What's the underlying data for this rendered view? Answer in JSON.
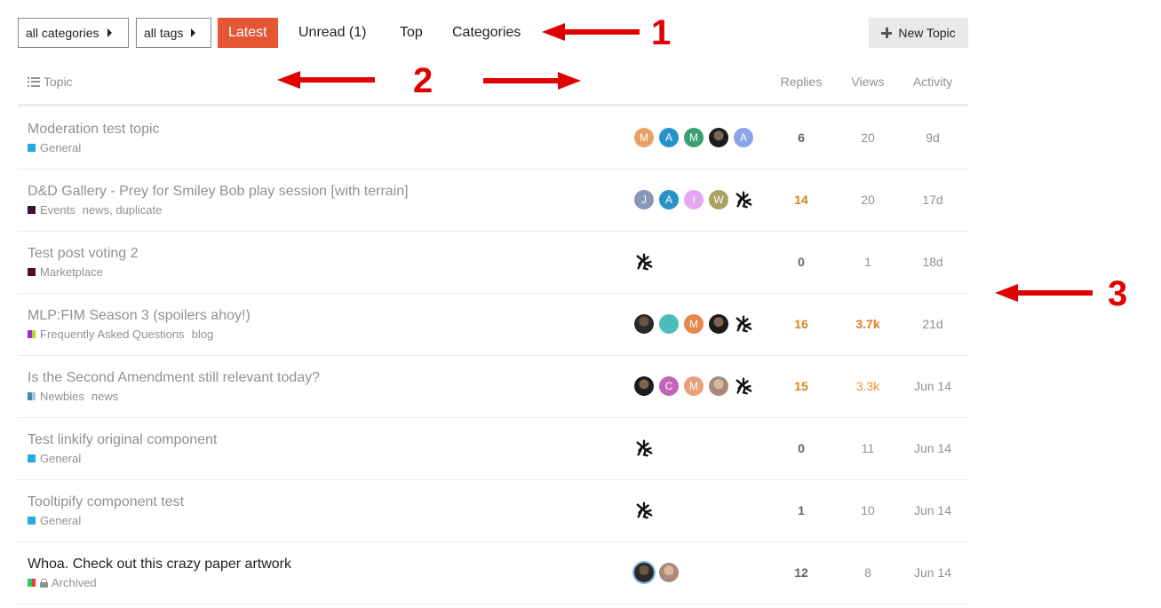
{
  "nav": {
    "categories_dropdown": "all categories",
    "tags_dropdown": "all tags",
    "items": [
      {
        "label": "Latest",
        "active": true
      },
      {
        "label": "Unread (1)",
        "active": false
      },
      {
        "label": "Top",
        "active": false
      },
      {
        "label": "Categories",
        "active": false
      }
    ],
    "new_topic": "New Topic"
  },
  "header": {
    "topic": "Topic",
    "replies": "Replies",
    "views": "Views",
    "activity": "Activity"
  },
  "topics": [
    {
      "title": "Moderation test topic",
      "category": "General",
      "category_colors": [
        "#25aae1"
      ],
      "tags": "",
      "posters": [
        {
          "letter": "M",
          "color": "#e7a066"
        },
        {
          "letter": "A",
          "color": "#2891c8"
        },
        {
          "letter": "M",
          "color": "#3aa06e"
        },
        {
          "letter": "",
          "color": "photo-dark"
        },
        {
          "letter": "A",
          "color": "#8da3e8"
        }
      ],
      "replies": "6",
      "views": "20",
      "activity": "9d"
    },
    {
      "title": "D&D Gallery - Prey for Smiley Bob play session [with terrain]",
      "category": "Events",
      "category_colors": [
        "#3b1630"
      ],
      "tags": "news, duplicate",
      "posters": [
        {
          "letter": "J",
          "color": "#8896b8"
        },
        {
          "letter": "A",
          "color": "#2891c8"
        },
        {
          "letter": "I",
          "color": "#e4a7f0"
        },
        {
          "letter": "W",
          "color": "#a8a160"
        },
        {
          "letter": "",
          "color": "bug"
        }
      ],
      "replies": "14",
      "views": "20",
      "activity": "17d"
    },
    {
      "title": "Test post voting 2",
      "category": "Marketplace",
      "category_colors": [
        "#4b1135"
      ],
      "tags": "",
      "posters": [
        {
          "letter": "",
          "color": "bug"
        }
      ],
      "replies": "0",
      "views": "1",
      "activity": "18d"
    },
    {
      "title": "MLP:FIM Season 3 (spoilers ahoy!)",
      "category": "Frequently Asked Questions",
      "category_colors": [
        "#9b2fd1",
        "#b8d61c"
      ],
      "tags": "blog",
      "posters": [
        {
          "letter": "",
          "color": "photo"
        },
        {
          "letter": "",
          "color": "photo-robot"
        },
        {
          "letter": "M",
          "color": "#e6874a"
        },
        {
          "letter": "",
          "color": "photo-dark"
        },
        {
          "letter": "",
          "color": "bug"
        }
      ],
      "replies": "16",
      "views": "3.7k",
      "activity": "21d"
    },
    {
      "title": "Is the Second Amendment still relevant today?",
      "category": "Newbies",
      "category_colors": [
        "#3b8fa6",
        "#9fd0d8"
      ],
      "tags": "news",
      "posters": [
        {
          "letter": "",
          "color": "photo-dark"
        },
        {
          "letter": "C",
          "color": "#c764b7"
        },
        {
          "letter": "M",
          "color": "#e8a07a"
        },
        {
          "letter": "",
          "color": "photo-light"
        },
        {
          "letter": "",
          "color": "bug"
        }
      ],
      "replies": "15",
      "views": "3.3k",
      "activity": "Jun 14"
    },
    {
      "title": "Test linkify original component",
      "category": "General",
      "category_colors": [
        "#25aae1"
      ],
      "tags": "",
      "posters": [
        {
          "letter": "",
          "color": "bug"
        }
      ],
      "replies": "0",
      "views": "11",
      "activity": "Jun 14"
    },
    {
      "title": "Tooltipify component test",
      "category": "General",
      "category_colors": [
        "#25aae1"
      ],
      "tags": "",
      "posters": [
        {
          "letter": "",
          "color": "bug"
        }
      ],
      "replies": "1",
      "views": "10",
      "activity": "Jun 14"
    },
    {
      "title": "Whoa. Check out this crazy paper artwork",
      "category": "Archived",
      "category_colors": [
        "#2ec95a",
        "#e43c3c"
      ],
      "tags": "",
      "posters": [
        {
          "letter": "",
          "color": "photo-ring"
        },
        {
          "letter": "",
          "color": "photo-light"
        }
      ],
      "replies": "12",
      "views": "8",
      "activity": "Jun 14"
    }
  ],
  "annotations": {
    "one": "1",
    "two": "2",
    "three": "3"
  },
  "colors": {
    "accent": "#e45735",
    "arrow": "#e00000",
    "muted_text": "#919191",
    "hot_orange": "#d4861a"
  }
}
